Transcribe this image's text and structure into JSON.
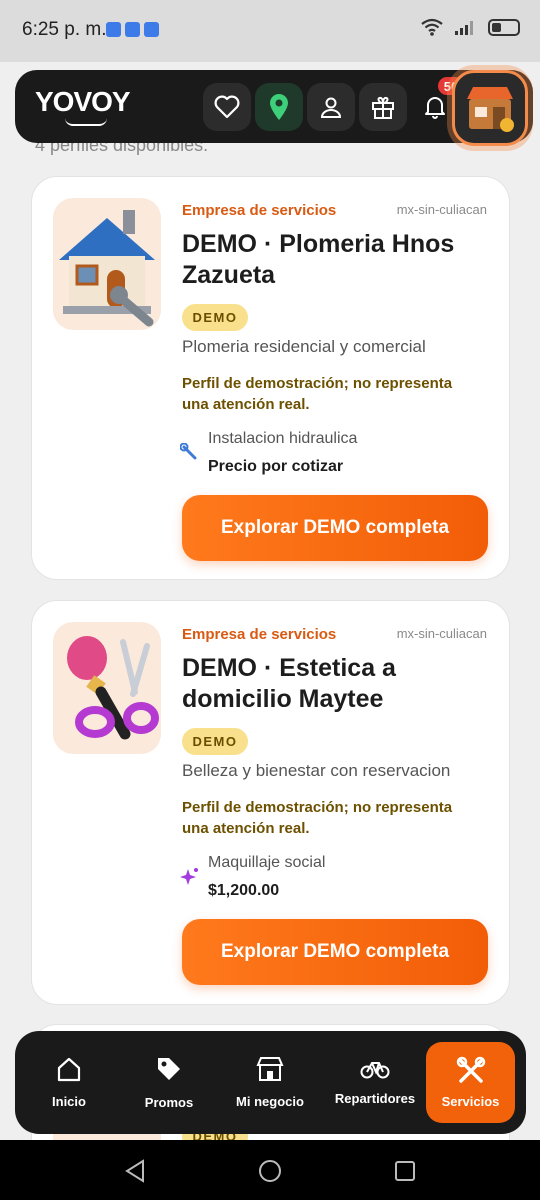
{
  "status": {
    "time": "6:25 p. m."
  },
  "header": {
    "logo": "YOVOY",
    "notifications_count": "50",
    "nav_icons": [
      "heart-icon",
      "map-pin-icon",
      "user-icon",
      "gift-icon",
      "bell-icon"
    ]
  },
  "results": {
    "count_text": "4 perfiles disponibles."
  },
  "cards": [
    {
      "type": "Empresa de servicios",
      "region": "mx-sin-culiacan",
      "title": "DEMO · Plomeria Hnos Zazueta",
      "badge": "DEMO",
      "description": "Plomeria residencial y comercial",
      "note": "Perfil de demostración; no representa una atención real.",
      "service_icon": "wrench-icon",
      "service_name": "Instalacion hidraulica",
      "service_price": "Precio por cotizar",
      "cta": "Explorar DEMO completa"
    },
    {
      "type": "Empresa de servicios",
      "region": "mx-sin-culiacan",
      "title": "DEMO · Estetica a domicilio Maytee",
      "badge": "DEMO",
      "description": "Belleza y bienestar con reservacion",
      "note": "Perfil de demostración; no representa una atención real.",
      "service_icon": "sparkles-icon",
      "service_name": "Maquillaje social",
      "service_price": "$1,200.00",
      "cta": "Explorar DEMO completa"
    },
    {
      "badge": "DEMO"
    }
  ],
  "bottom_nav": [
    {
      "label": "Inicio",
      "icon": "home-icon"
    },
    {
      "label": "Promos",
      "icon": "tag-icon"
    },
    {
      "label": "Mi negocio",
      "icon": "store-icon"
    },
    {
      "label": "Repartidores",
      "icon": "bicycle-icon"
    },
    {
      "label": "Servicios",
      "icon": "tools-icon",
      "active": true
    }
  ],
  "colors": {
    "accent": "#f2620a",
    "nav_bg": "#1a1a1a",
    "badge_bg": "#f8e08c",
    "note_text": "#6d5100"
  }
}
